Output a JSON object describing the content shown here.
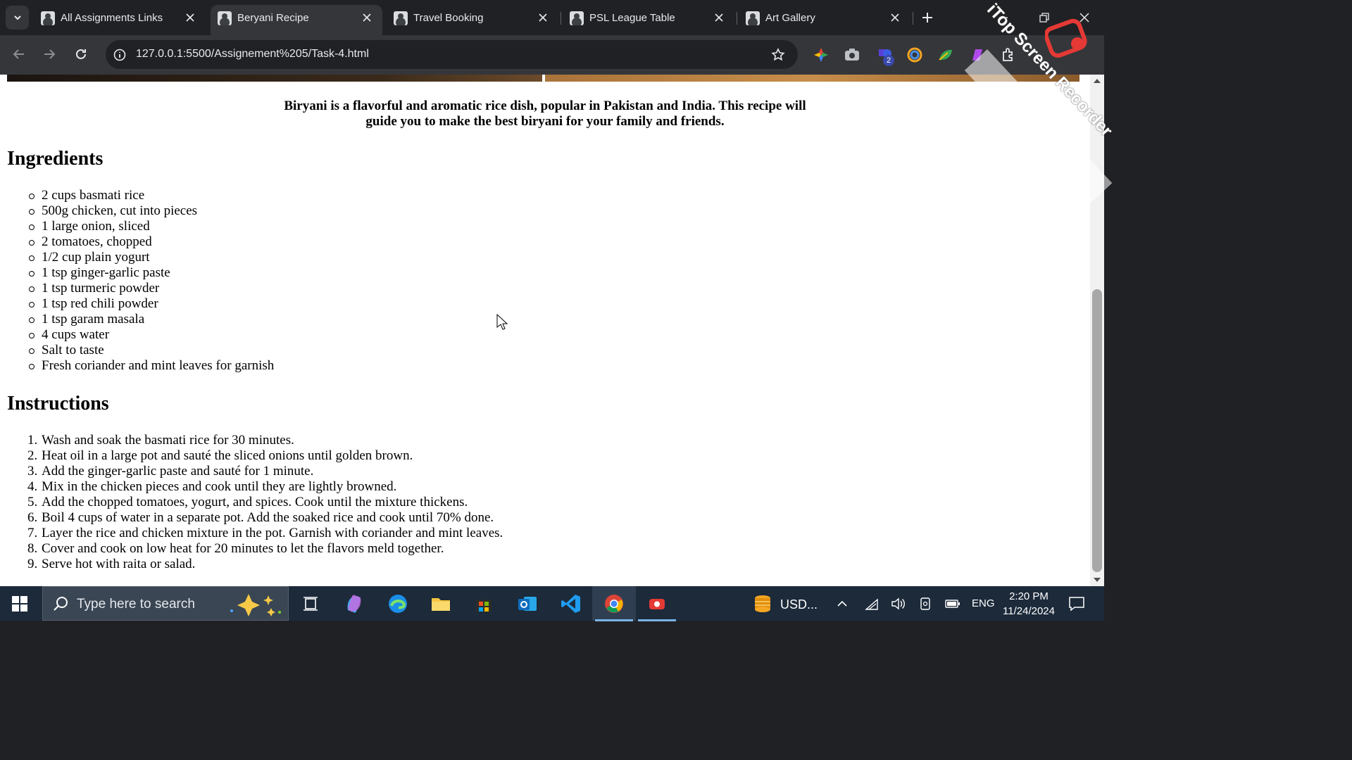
{
  "browser": {
    "tabs": [
      {
        "title": "All Assignments Links",
        "active": false
      },
      {
        "title": "Beryani Recipe",
        "active": true
      },
      {
        "title": "Travel Booking",
        "active": false
      },
      {
        "title": "PSL League Table",
        "active": false
      },
      {
        "title": "Art Gallery",
        "active": false
      }
    ],
    "url": "127.0.0.1:5500/Assignement%205/Task-4.html",
    "extension_badge": "2"
  },
  "page": {
    "intro": "Biryani is a flavorful and aromatic rice dish, popular in Pakistan and India. This recipe will guide you to make the best biryani for your family and friends.",
    "ingredients_title": "Ingredients",
    "ingredients": [
      "2 cups basmati rice",
      "500g chicken, cut into pieces",
      "1 large onion, sliced",
      "2 tomatoes, chopped",
      "1/2 cup plain yogurt",
      "1 tsp ginger-garlic paste",
      "1 tsp turmeric powder",
      "1 tsp red chili powder",
      "1 tsp garam masala",
      "4 cups water",
      "Salt to taste",
      "Fresh coriander and mint leaves for garnish"
    ],
    "instructions_title": "Instructions",
    "instructions": [
      {
        "num": "1.",
        "text": "Wash and soak the basmati rice for 30 minutes."
      },
      {
        "num": "2.",
        "text": "Heat oil in a large pot and sauté the sliced onions until golden brown."
      },
      {
        "num": "3.",
        "text": "Add the ginger-garlic paste and sauté for 1 minute."
      },
      {
        "num": "4.",
        "text": "Mix in the chicken pieces and cook until they are lightly browned."
      },
      {
        "num": "5.",
        "text": "Add the chopped tomatoes, yogurt, and spices. Cook until the mixture thickens."
      },
      {
        "num": "6.",
        "text": "Boil 4 cups of water in a separate pot. Add the soaked rice and cook until 70% done."
      },
      {
        "num": "7.",
        "text": "Layer the rice and chicken mixture in the pot. Garnish with coriander and mint leaves."
      },
      {
        "num": "8.",
        "text": "Cover and cook on low heat for 20 minutes to let the flavors meld together."
      },
      {
        "num": "9.",
        "text": "Serve hot with raita or salad."
      }
    ]
  },
  "watermark": {
    "text": "iTop Screen Recorder"
  },
  "taskbar": {
    "search_placeholder": "Type here to search",
    "weather": "USD...",
    "language": "ENG",
    "time": "2:20 PM",
    "date": "11/24/2024"
  },
  "colors": {
    "tab_strip": "#202124",
    "toolbar": "#35363a",
    "taskbar": "#1c2a3a",
    "page_bg": "#ffffff"
  }
}
